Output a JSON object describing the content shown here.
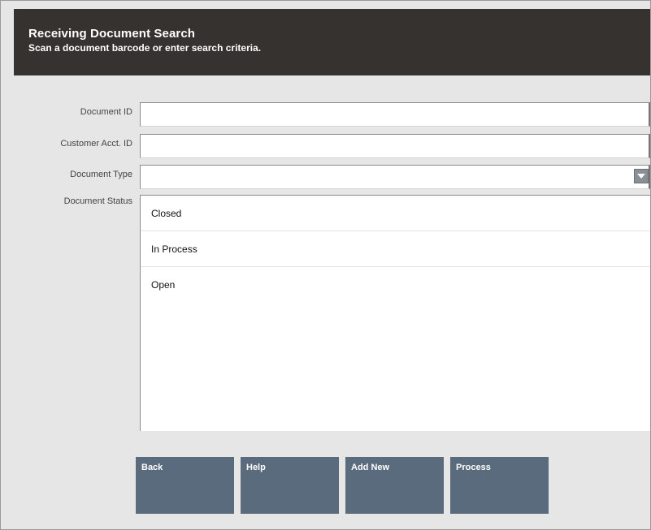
{
  "header": {
    "title": "Receiving Document Search",
    "subtitle": "Scan a document barcode or enter search criteria."
  },
  "form": {
    "document_id": {
      "label": "Document ID",
      "value": ""
    },
    "customer_acct_id": {
      "label": "Customer Acct. ID",
      "value": ""
    },
    "document_type": {
      "label": "Document Type",
      "value": "",
      "icon": "dropdown-arrow-icon"
    },
    "document_status": {
      "label": "Document Status",
      "options": [
        "Closed",
        "In Process",
        "Open"
      ]
    }
  },
  "buttons": {
    "back": "Back",
    "help": "Help",
    "add_new": "Add New",
    "process": "Process"
  },
  "colors": {
    "header_bg": "#35322f",
    "button_bg": "#5a6b7e",
    "page_bg": "#e6e6e6"
  }
}
